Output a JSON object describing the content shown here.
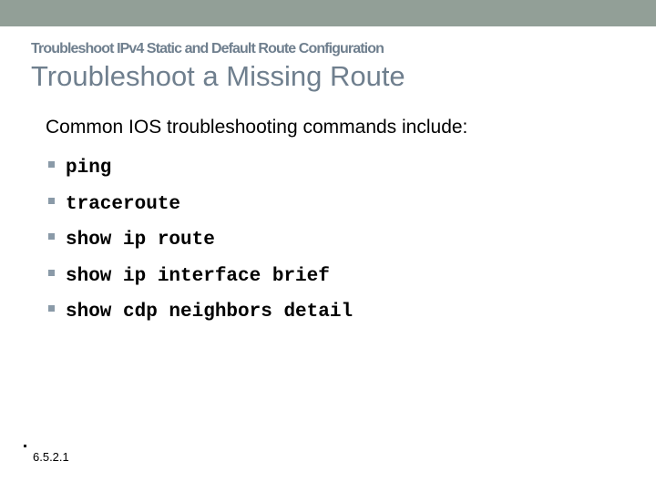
{
  "header": {
    "subtitle": "Troubleshoot IPv4 Static and Default Route Configuration",
    "title": "Troubleshoot a Missing Route"
  },
  "body": {
    "intro": "Common IOS troubleshooting commands include:",
    "commands": [
      "ping",
      "traceroute",
      "show ip route",
      "show ip interface brief",
      "show cdp neighbors detail"
    ]
  },
  "footer": {
    "reference": "6.5.2.1"
  },
  "colors": {
    "top_bar": "#929f97",
    "title": "#6f7f8e",
    "bullet": "#8a9aa8"
  }
}
